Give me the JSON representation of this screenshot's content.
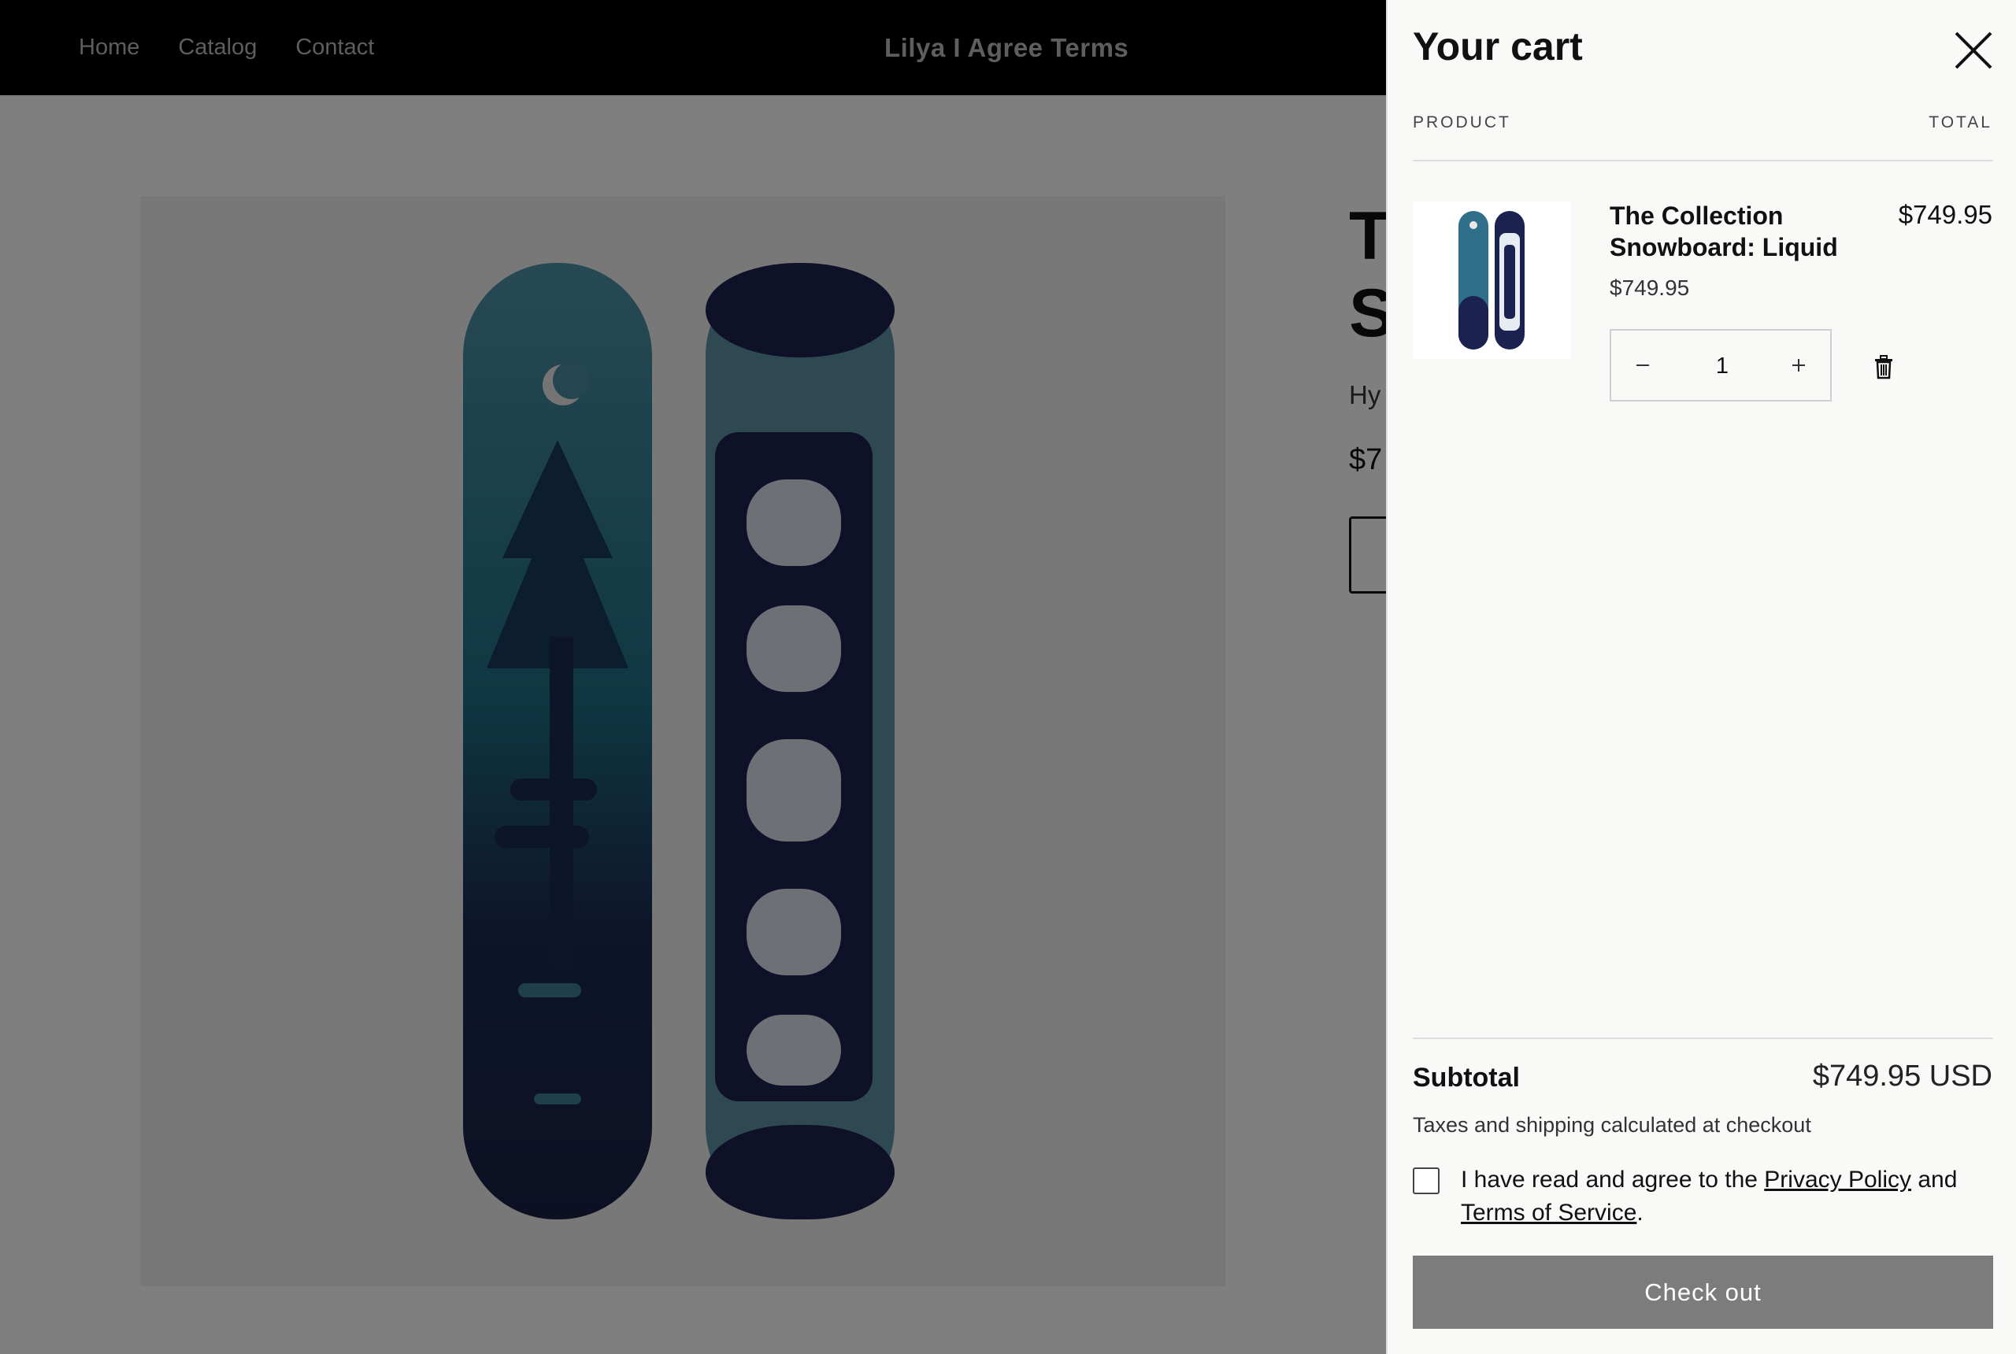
{
  "header": {
    "nav": [
      "Home",
      "Catalog",
      "Contact"
    ],
    "brand": "Lilya I Agree Terms"
  },
  "product_page": {
    "title_visible": "T\nS",
    "subtitle_visible": "Hy",
    "price_visible": "$7"
  },
  "cart": {
    "title": "Your cart",
    "col_product": "PRODUCT",
    "col_total": "TOTAL",
    "item": {
      "name": "The Collection Snowboard: Liquid",
      "unit_price": "$749.95",
      "line_total": "$749.95",
      "quantity": "1"
    },
    "subtotal_label": "Subtotal",
    "subtotal_value": "$749.95 USD",
    "tax_note": "Taxes and shipping calculated at checkout",
    "agree_prefix": "I have read and agree to the ",
    "privacy_link": "Privacy Policy",
    "agree_mid": " and",
    "terms_link": "Terms of Service",
    "agree_suffix": ".",
    "checkout_label": "Check out"
  },
  "colors": {
    "overlay": "rgba(0,0,0,0.5)",
    "drawer_bg": "#f9f9f7",
    "checkout_bg": "#7c7c7c",
    "board_dark": "#1d2a4d",
    "board_teal": "#3e7f95"
  },
  "icons": [
    "close-icon",
    "minus-icon",
    "plus-icon",
    "trash-icon"
  ]
}
